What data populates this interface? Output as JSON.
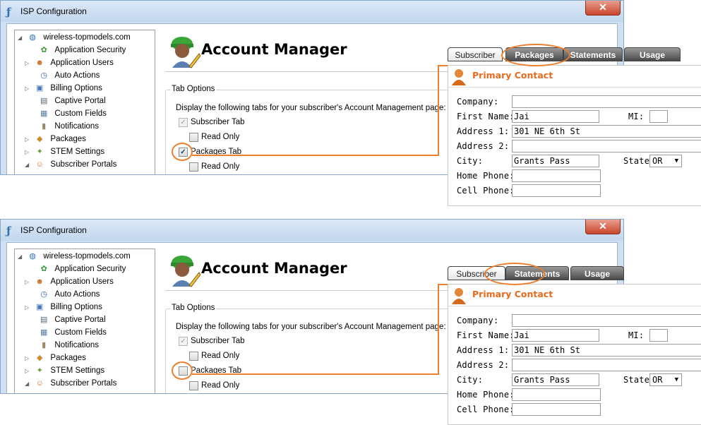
{
  "window": {
    "title": "ISP Configuration",
    "close_label": "✕"
  },
  "tree": {
    "items": [
      {
        "label": "wireless-topmodels.com",
        "icon": "globe-icon",
        "glyph": "◍",
        "color": "#2f6fb4",
        "arrow": "◢"
      },
      {
        "label": "Application Security",
        "icon": "shield-users-icon",
        "glyph": "✿",
        "color": "#3a9a3a",
        "arrow": ""
      },
      {
        "label": "Application Users",
        "icon": "users-icon",
        "glyph": "☻",
        "color": "#c8702c",
        "arrow": "▷"
      },
      {
        "label": "Auto Actions",
        "icon": "clock-icon",
        "glyph": "◷",
        "color": "#3060a0",
        "arrow": ""
      },
      {
        "label": "Billing Options",
        "icon": "billing-icon",
        "glyph": "▣",
        "color": "#4478b8",
        "arrow": "▷"
      },
      {
        "label": "Captive Portal",
        "icon": "captive-portal-icon",
        "glyph": "▤",
        "color": "#556677",
        "arrow": ""
      },
      {
        "label": "Custom Fields",
        "icon": "custom-fields-icon",
        "glyph": "▦",
        "color": "#5a7fa8",
        "arrow": ""
      },
      {
        "label": "Notifications",
        "icon": "notification-icon",
        "glyph": "▮",
        "color": "#9a8a6a",
        "arrow": ""
      },
      {
        "label": "Packages",
        "icon": "package-icon",
        "glyph": "◆",
        "color": "#c89030",
        "arrow": "▷"
      },
      {
        "label": "STEM Settings",
        "icon": "stem-settings-icon",
        "glyph": "✦",
        "color": "#6a9a3a",
        "arrow": "▷"
      },
      {
        "label": "Subscriber Portals",
        "icon": "subscriber-portals-icon",
        "glyph": "☺",
        "color": "#c86a2c",
        "arrow": "◢"
      }
    ]
  },
  "account_manager": {
    "title": "Account Manager",
    "tab_options_legend": "Tab Options",
    "description": "Display the following tabs for your subscriber's Account Management page:",
    "subscriber_tab": "Subscriber Tab",
    "read_only": "Read Only",
    "packages_tab": "Packages Tab",
    "check_glyph": "✓"
  },
  "panels": {
    "top": {
      "packages_checked": true,
      "tabs": [
        {
          "label": "Subscriber",
          "style": "light"
        },
        {
          "label": "Packages",
          "style": "dark"
        },
        {
          "label": "Statements",
          "style": "dark"
        },
        {
          "label": "Usage",
          "style": "dark"
        }
      ]
    },
    "bottom": {
      "packages_checked": false,
      "tabs": [
        {
          "label": "Subscriber",
          "style": "light"
        },
        {
          "label": "Statements",
          "style": "dark"
        },
        {
          "label": "Usage",
          "style": "dark"
        }
      ]
    }
  },
  "contact": {
    "title": "Primary Contact",
    "company_label": "Company:",
    "company_value": "",
    "first_name_label": "First Name:",
    "first_name_value": "Jai",
    "mi_label": "MI:",
    "mi_value": "",
    "address1_label": "Address 1:",
    "address1_value": "301 NE 6th St",
    "address2_label": "Address 2:",
    "address2_value": "",
    "city_label": "City:",
    "city_value": "Grants Pass",
    "state_label": "State:",
    "state_value": "OR",
    "home_phone_label": "Home Phone:",
    "home_phone_value": "",
    "cell_phone_label": "Cell Phone:",
    "cell_phone_value": ""
  },
  "colors": {
    "highlight": "#ee7f2d",
    "contact_title": "#e76b1c",
    "tab_dark": "#4a4a4a"
  }
}
